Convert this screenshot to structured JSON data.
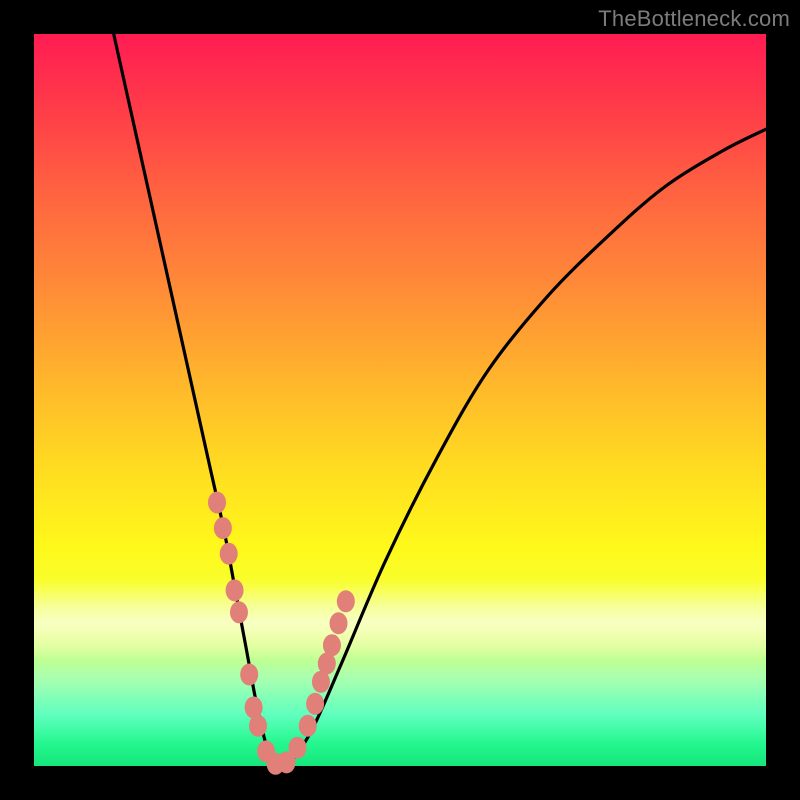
{
  "watermark": "TheBottleneck.com",
  "chart_data": {
    "type": "line",
    "title": "",
    "xlabel": "",
    "ylabel": "",
    "xlim": [
      0,
      100
    ],
    "ylim": [
      0,
      100
    ],
    "grid": false,
    "legend": false,
    "series": [
      {
        "name": "bottleneck-curve",
        "color": "#000000",
        "x": [
          10,
          14,
          18,
          22,
          24,
          26,
          27.5,
          29,
          30.5,
          32,
          33.5,
          35,
          38,
          42,
          48,
          55,
          62,
          70,
          78,
          86,
          94,
          100
        ],
        "y": [
          104,
          86,
          68,
          50,
          41,
          32,
          24,
          16,
          8,
          2,
          0,
          0.5,
          5,
          14,
          28,
          42,
          54,
          64,
          72,
          79,
          84,
          87
        ]
      }
    ],
    "markers": [
      {
        "name": "data-dots",
        "color": "#e08079",
        "x": [
          25.0,
          25.8,
          26.6,
          27.4,
          28.0,
          29.4,
          30.0,
          30.6,
          31.7,
          33.0,
          34.5,
          36.0,
          37.4,
          38.4,
          39.2,
          40.0,
          40.7,
          41.6,
          42.6
        ],
        "y": [
          36.0,
          32.5,
          29.0,
          24.0,
          21.0,
          12.5,
          8.0,
          5.5,
          2.0,
          0.3,
          0.5,
          2.5,
          5.5,
          8.5,
          11.5,
          14.0,
          16.5,
          19.5,
          22.5
        ]
      }
    ],
    "background": {
      "type": "vertical-gradient",
      "stops": [
        {
          "pos": 0.0,
          "color": "#ff1c53"
        },
        {
          "pos": 0.35,
          "color": "#ff8c37"
        },
        {
          "pos": 0.6,
          "color": "#ffde20"
        },
        {
          "pos": 0.8,
          "color": "#f0ff60"
        },
        {
          "pos": 0.93,
          "color": "#5fffbe"
        },
        {
          "pos": 1.0,
          "color": "#14e67a"
        }
      ]
    }
  }
}
